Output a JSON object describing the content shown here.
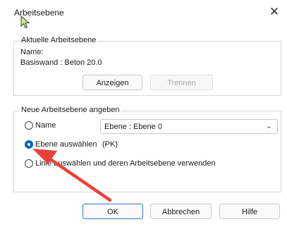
{
  "dialog": {
    "title": "Arbeitsebene",
    "close_glyph": "✕"
  },
  "current": {
    "legend": "Aktuelle Arbeitsebene",
    "name_label": "Name:",
    "name_value": "Basiswand : Beton 20.0",
    "show_button": "Anzeigen",
    "detach_button": "Trennen"
  },
  "new_plane": {
    "legend": "Neue Arbeitsebene angeben",
    "option_name": "Name",
    "name_select_value": "Ebene : Ebene 0",
    "option_pick_plane": "Ebene auswählen",
    "option_pick_plane_suffix": "(PK)",
    "option_pick_line": "Linie auswählen und deren Arbeitsebene verwenden",
    "selected": "pick_plane"
  },
  "footer": {
    "ok": "OK",
    "cancel": "Abbrechen",
    "help": "Hilfe"
  },
  "colors": {
    "accent": "#0067c0",
    "annotation_arrow": "#e8413a"
  }
}
